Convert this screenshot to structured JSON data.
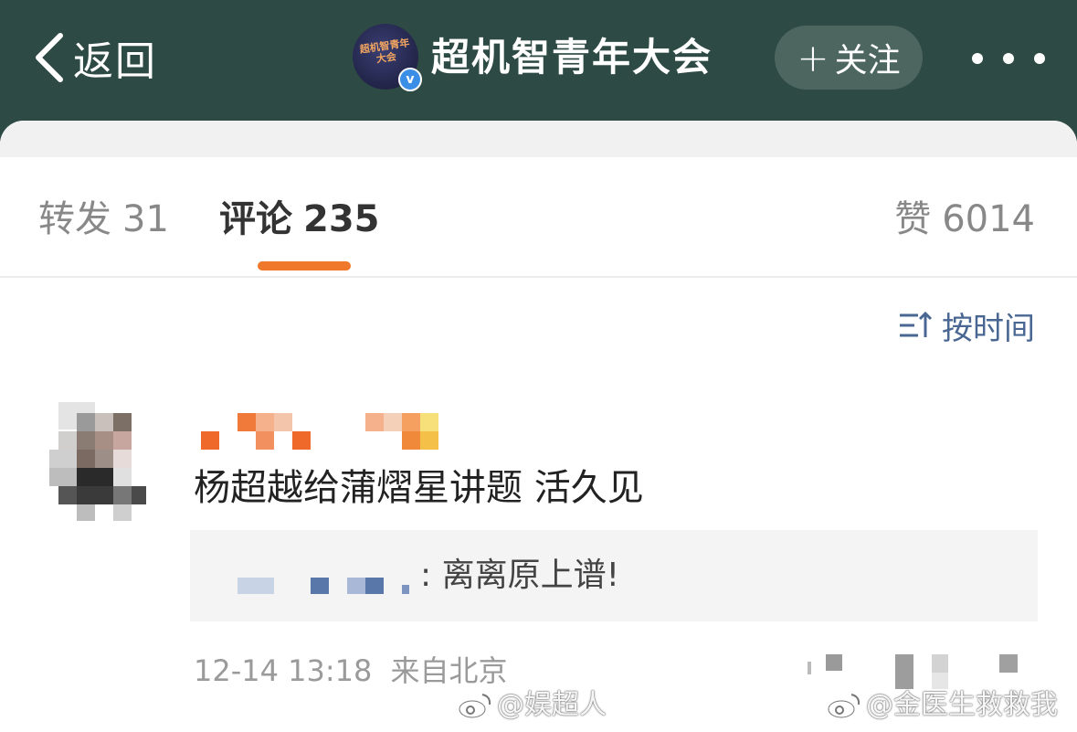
{
  "header": {
    "back_label": "返回",
    "account_name": "超机智青年大会",
    "follow_label": "关注",
    "avatar_logo_text": "超机智青年大会",
    "verified_mark": "v",
    "bg_color": "#2e4a44"
  },
  "tabs": {
    "repost": {
      "label": "转发",
      "count": "31"
    },
    "comment": {
      "label": "评论",
      "count": "235"
    },
    "like": {
      "label": "赞",
      "count": "6014"
    },
    "accent_color": "#f0782a"
  },
  "sort": {
    "label": "按时间",
    "icon": "sort-icon"
  },
  "comment": {
    "text": "杨超越给蒲熠星讲题 活久见",
    "reply_text": ": 离离原上谱!",
    "timestamp": "12-14 13:18",
    "location": "来自北京"
  },
  "watermarks": {
    "left": "@娱超人",
    "right": "@金医生救救我"
  }
}
